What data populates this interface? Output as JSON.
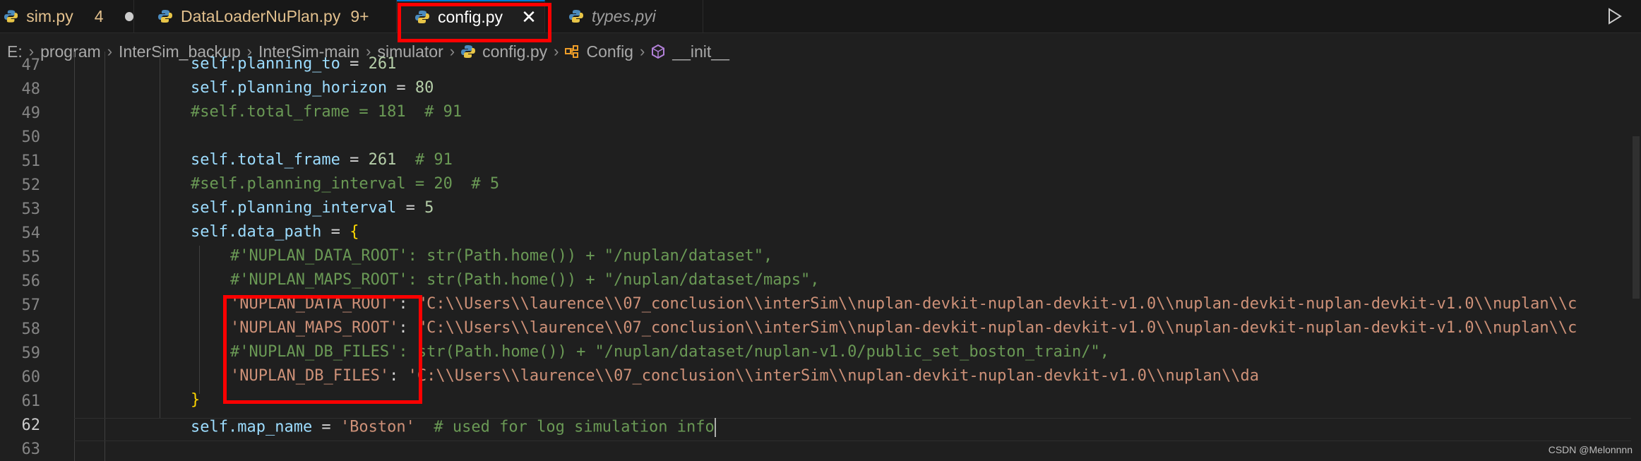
{
  "tabs": [
    {
      "label": "sim.py",
      "count": "4",
      "modified": true
    },
    {
      "label": "DataLoaderNuPlan.py",
      "count": "9+"
    },
    {
      "label": "config.py",
      "active": true,
      "close": "✕"
    },
    {
      "label": "types.pyi"
    }
  ],
  "breadcrumb": [
    "E:",
    "program",
    "InterSim_backup",
    "InterSim-main",
    "simulator",
    "config.py",
    "Config",
    "__init__"
  ],
  "line_numbers": [
    "47",
    "48",
    "49",
    "50",
    "51",
    "52",
    "53",
    "54",
    "55",
    "56",
    "57",
    "58",
    "59",
    "60",
    "61",
    "62",
    "63"
  ],
  "active_line": "62",
  "code": {
    "l47": {
      "self": "self.planning_to",
      "op": " = ",
      "num": "261"
    },
    "l48": {
      "self": "self.planning_horizon",
      "op": " = ",
      "num": "80"
    },
    "l49": {
      "cmt": "#self.total_frame = 181  # 91"
    },
    "l51": {
      "self": "self.total_frame",
      "op": " = ",
      "num": "261",
      "cmt": "  # 91"
    },
    "l52": {
      "cmt": "#self.planning_interval = 20  # 5"
    },
    "l53": {
      "self": "self.planning_interval",
      "op": " = ",
      "num": "5"
    },
    "l54": {
      "self": "self.data_path",
      "op": " = ",
      "brace": "{"
    },
    "l55": {
      "cmt": "#'NUPLAN_DATA_ROOT': str(Path.home()) + \"/nuplan/dataset\","
    },
    "l56": {
      "cmt": "#'NUPLAN_MAPS_ROOT': str(Path.home()) + \"/nuplan/dataset/maps\","
    },
    "l57": {
      "key": "'NUPLAN_DATA_ROOT'",
      "op": ": ",
      "val": "\"C:\\\\Users\\\\laurence\\\\07_conclusion\\\\interSim\\\\nuplan-devkit-nuplan-devkit-v1.0\\\\nuplan-devkit-nuplan-devkit-v1.0\\\\nuplan\\\\c"
    },
    "l58": {
      "key": "'NUPLAN_MAPS_ROOT'",
      "op": ": ",
      "val": "\"C:\\\\Users\\\\laurence\\\\07_conclusion\\\\interSim\\\\nuplan-devkit-nuplan-devkit-v1.0\\\\nuplan-devkit-nuplan-devkit-v1.0\\\\nuplan\\\\c"
    },
    "l59": {
      "cmt": "#'NUPLAN_DB_FILES': str(Path.home()) + \"/nuplan/dataset/nuplan-v1.0/public_set_boston_train/\","
    },
    "l60": {
      "key": "'NUPLAN_DB_FILES'",
      "op": ": ",
      "val": "'C:\\\\Users\\\\laurence\\\\07_conclusion\\\\interSim\\\\nuplan-devkit-nuplan-devkit-v1.0\\\\nuplan\\\\da"
    },
    "l61": {
      "brace": "}"
    },
    "l62": {
      "self": "self.map_name",
      "op": " = ",
      "str": "'Boston'",
      "cmt": "  # used for log simulation info"
    }
  },
  "watermark": "CSDN @Melonnnn",
  "colors": {
    "highlight_box": "#ff0000",
    "background": "#1f1f1f",
    "tabbar": "#181818"
  }
}
